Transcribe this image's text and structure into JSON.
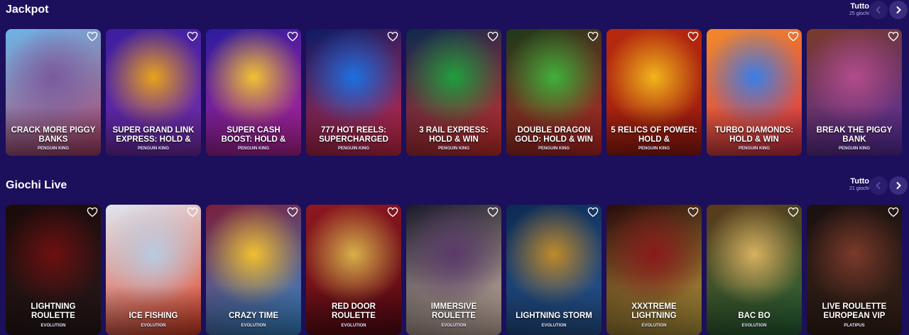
{
  "sections": [
    {
      "title": "Jackpot",
      "all_label": "Tutto",
      "count_label": "25 giochi",
      "games": [
        {
          "title": "CRACK MORE PIGGY BANKS",
          "provider": "PENGUIN KING",
          "colors": [
            "#6db5e6",
            "#7a5a9c",
            "#b2406a"
          ]
        },
        {
          "title": "SUPER GRAND LINK EXPRESS: HOLD &",
          "provider": "PENGUIN KING",
          "colors": [
            "#3b1e9e",
            "#e8a21c",
            "#7b2fb0"
          ]
        },
        {
          "title": "SUPER CASH BOOST: HOLD &",
          "provider": "PENGUIN KING",
          "colors": [
            "#2b1c9e",
            "#f2c233",
            "#c0249c"
          ]
        },
        {
          "title": "777 HOT REELS: SUPERCHARGED",
          "provider": "PENGUIN KING",
          "colors": [
            "#0a1c66",
            "#1c6fe0",
            "#d92b4a"
          ]
        },
        {
          "title": "3 RAIL EXPRESS: HOLD & WIN",
          "provider": "PENGUIN KING",
          "colors": [
            "#0b2a4e",
            "#1f9e3d",
            "#d8312e"
          ]
        },
        {
          "title": "DOUBLE DRAGON GOLD: HOLD & WIN",
          "provider": "PENGUIN KING",
          "colors": [
            "#1b3a1a",
            "#3fb03a",
            "#c62828"
          ]
        },
        {
          "title": "5 RELICS OF POWER: HOLD &",
          "provider": "PENGUIN KING",
          "colors": [
            "#b82a0e",
            "#f2b51c",
            "#9c1a10"
          ]
        },
        {
          "title": "TURBO DIAMONDS: HOLD & WIN",
          "provider": "PENGUIN KING",
          "colors": [
            "#f08a2c",
            "#3a7ee8",
            "#d8304a"
          ]
        },
        {
          "title": "BREAK THE PIGGY BANK",
          "provider": "PENGUIN KING",
          "colors": [
            "#7a3a2a",
            "#b14c8c",
            "#5b2fa8"
          ]
        }
      ]
    },
    {
      "title": "Giochi Live",
      "all_label": "Tutto",
      "count_label": "21 giochi",
      "games": [
        {
          "title": "LIGHTNING ROULETTE",
          "provider": "EVOLUTION",
          "colors": [
            "#1a0a0a",
            "#6e1010",
            "#2a1a1a"
          ]
        },
        {
          "title": "ICE FISHING",
          "provider": "EVOLUTION",
          "colors": [
            "#dfe8f1",
            "#b9cbe0",
            "#e04024"
          ]
        },
        {
          "title": "CRAZY TIME",
          "provider": "EVOLUTION",
          "colors": [
            "#7a1e3a",
            "#f0c030",
            "#3b8fd6"
          ]
        },
        {
          "title": "RED DOOR ROULETTE",
          "provider": "EVOLUTION",
          "colors": [
            "#8e1820",
            "#d8b04a",
            "#5a0a14"
          ]
        },
        {
          "title": "IMMERSIVE ROULETTE",
          "provider": "EVOLUTION",
          "colors": [
            "#1a1a2a",
            "#5a3a6a",
            "#d8c0b0"
          ]
        },
        {
          "title": "LIGHTNING STORM",
          "provider": "EVOLUTION",
          "colors": [
            "#0c2a52",
            "#c08a2a",
            "#2a5a9a"
          ]
        },
        {
          "title": "XXXTREME LIGHTNING",
          "provider": "EVOLUTION",
          "colors": [
            "#2a0a0a",
            "#8a1a1a",
            "#c0a040"
          ]
        },
        {
          "title": "BAC BO",
          "provider": "EVOLUTION",
          "colors": [
            "#5a3a1a",
            "#d8b060",
            "#2a6a3a"
          ]
        },
        {
          "title": "LIVE ROULETTE EUROPEAN VIP",
          "provider": "PLATIPUS",
          "colors": [
            "#1a1010",
            "#7a3a2a",
            "#3a2418"
          ]
        }
      ]
    }
  ]
}
